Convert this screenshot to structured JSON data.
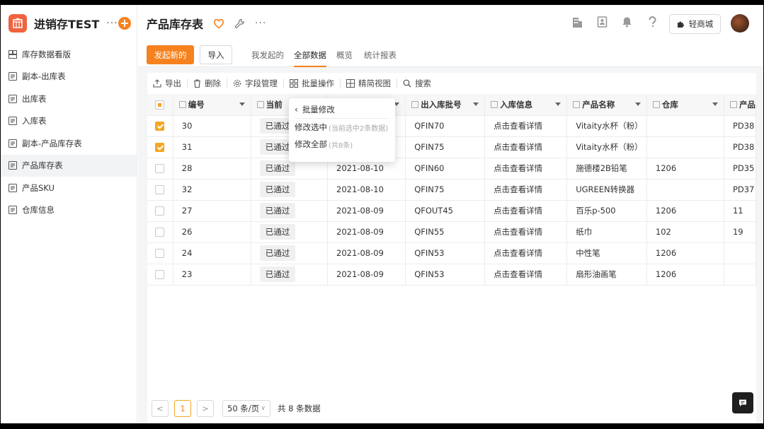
{
  "app": {
    "name": "进销存TEST",
    "more": "···",
    "add": "+"
  },
  "sidebar": {
    "items": [
      {
        "label": "库存数据看版",
        "icon": "dashboard-icon"
      },
      {
        "label": "副本-出库表",
        "icon": "form-icon"
      },
      {
        "label": "出库表",
        "icon": "form-icon"
      },
      {
        "label": "入库表",
        "icon": "form-icon"
      },
      {
        "label": "副本-产品库存表",
        "icon": "form-icon"
      },
      {
        "label": "产品库存表",
        "icon": "form-icon",
        "active": true
      },
      {
        "label": "产品SKU",
        "icon": "form-icon"
      },
      {
        "label": "仓库信息",
        "icon": "form-icon"
      }
    ]
  },
  "header": {
    "title": "产品库存表",
    "shop_button": "轻商城",
    "icons": [
      "favorite-heart-icon",
      "wrench-icon",
      "more-icon",
      "building-icon",
      "contacts-icon",
      "bell-icon",
      "help-icon",
      "avatar"
    ]
  },
  "actions": {
    "new_button": "发起新的",
    "import_button": "导入",
    "tabs": [
      {
        "label": "我发起的",
        "active": false
      },
      {
        "label": "全部数据",
        "active": true
      },
      {
        "label": "概览",
        "active": false
      },
      {
        "label": "统计报表",
        "active": false
      }
    ]
  },
  "grid_tools": {
    "export": "导出",
    "delete": "删除",
    "fields": "字段管理",
    "batch": "批量操作",
    "simple_view": "精简视图",
    "search": "搜索"
  },
  "dropdown": {
    "back_label": "批量修改",
    "items": [
      {
        "label": "修改选中",
        "hint": "(当前选中2条数据)"
      },
      {
        "label": "修改全部",
        "hint": "(共8条)"
      }
    ]
  },
  "table": {
    "columns": [
      "编号",
      "当前",
      "",
      "出入库批号",
      "入库信息",
      "产品名称",
      "仓库",
      "产品"
    ],
    "rows": [
      {
        "checked": true,
        "id": "30",
        "status": "已通过",
        "date": "",
        "batch": "QFIN70",
        "info": "点击查看详情",
        "product": "Vitaity水杯（粉）",
        "warehouse": "",
        "code": "PD38"
      },
      {
        "checked": true,
        "id": "31",
        "status": "已通过",
        "date": "",
        "batch": "QFIN75",
        "info": "点击查看详情",
        "product": "Vitaity水杯（粉）",
        "warehouse": "",
        "code": "PD38"
      },
      {
        "checked": false,
        "id": "28",
        "status": "已通过",
        "date": "2021-08-10",
        "batch": "QFIN60",
        "info": "点击查看详情",
        "product": "施德楼2B铅笔",
        "warehouse": "1206",
        "code": "PD35"
      },
      {
        "checked": false,
        "id": "32",
        "status": "已通过",
        "date": "2021-08-10",
        "batch": "QFIN75",
        "info": "点击查看详情",
        "product": "UGREEN转换器",
        "warehouse": "",
        "code": "PD37"
      },
      {
        "checked": false,
        "id": "27",
        "status": "已通过",
        "date": "2021-08-09",
        "batch": "QFOUT45",
        "info": "点击查看详情",
        "product": "百乐p-500",
        "warehouse": "1206",
        "code": "11"
      },
      {
        "checked": false,
        "id": "26",
        "status": "已通过",
        "date": "2021-08-09",
        "batch": "QFIN55",
        "info": "点击查看详情",
        "product": "纸巾",
        "warehouse": "102",
        "code": "19"
      },
      {
        "checked": false,
        "id": "24",
        "status": "已通过",
        "date": "2021-08-09",
        "batch": "QFIN53",
        "info": "点击查看详情",
        "product": "中性笔",
        "warehouse": "1206",
        "code": ""
      },
      {
        "checked": false,
        "id": "23",
        "status": "已通过",
        "date": "2021-08-09",
        "batch": "QFIN53",
        "info": "点击查看详情",
        "product": "扇形油画笔",
        "warehouse": "1206",
        "code": ""
      }
    ]
  },
  "pagination": {
    "current": "1",
    "prev": "<",
    "next": ">",
    "page_size": "50 条/页",
    "total": "共 8 条数据"
  },
  "colors": {
    "accent": "#f5821f",
    "checkbox": "#f5a623"
  }
}
